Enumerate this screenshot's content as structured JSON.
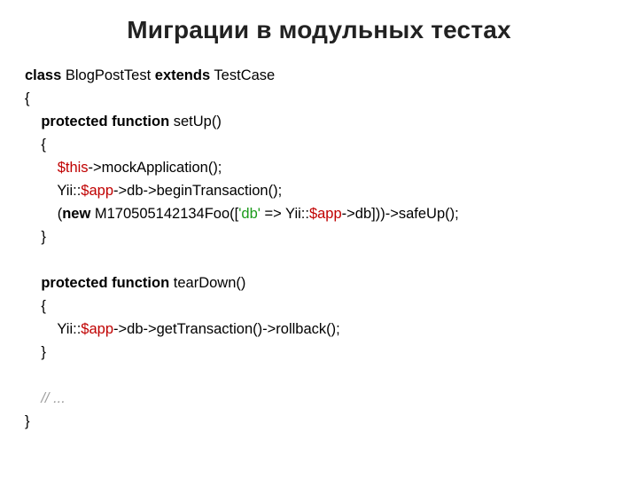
{
  "title": "Миграции в модульных тестах",
  "code": {
    "kw_class": "class",
    "class_name": " BlogPostTest ",
    "kw_extends": "extends",
    "extends_name": " TestCase",
    "brace_open": "{",
    "kw_protected_function_1": "protected function",
    "setup_sig": " setUp()",
    "setup_brace_open": "{",
    "this_var": "$this",
    "this_rest": "->mockApplication();",
    "yii_app_1_pre": "Yii::",
    "yii_app_1_var": "$app",
    "yii_app_1_rest": "->db->beginTransaction();",
    "new_pre": "(",
    "kw_new": "new",
    "new_mid1": " M170505142134Foo([",
    "db_key": "'db'",
    "new_mid2": " => Yii::",
    "yii_app_2_var": "$app",
    "new_rest": "->db]))->safeUp();",
    "setup_brace_close": "}",
    "blank": "",
    "kw_protected_function_2": "protected function",
    "teardown_sig": " tearDown()",
    "teardown_brace_open": "{",
    "yii_app_3_pre": "Yii::",
    "yii_app_3_var": "$app",
    "yii_app_3_rest": "->db->getTransaction()->rollback();",
    "teardown_brace_close": "}",
    "comment": "// ...",
    "brace_close": "}"
  }
}
